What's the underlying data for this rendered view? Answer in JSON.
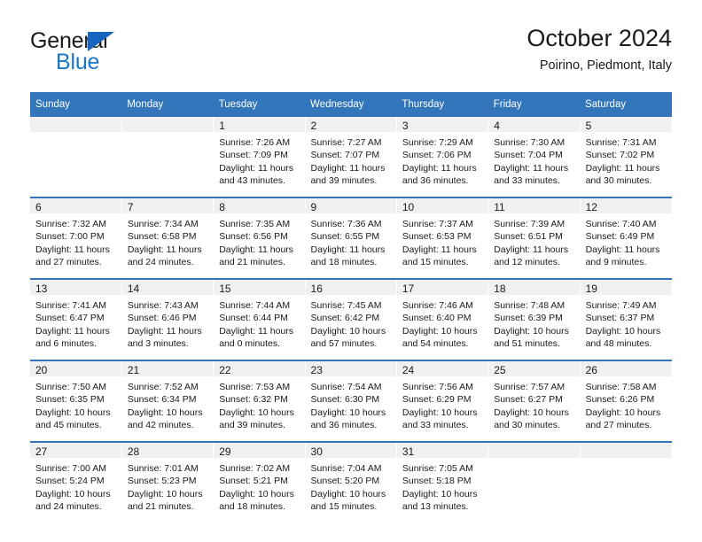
{
  "brand": {
    "name_part1": "General",
    "name_part2": "Blue",
    "triangle_icon": "blue-triangle-logo-mark",
    "colors": {
      "dark": "#1b1b1b",
      "blue": "#1878c8",
      "triangle": "#1565c0"
    }
  },
  "header": {
    "title": "October 2024",
    "subtitle": "Poirino, Piedmont, Italy"
  },
  "theme": {
    "header_bg": "#3275ba",
    "header_text": "#ffffff",
    "daynum_band_bg": "#f0f0f0",
    "cell_bg": "#ffffff",
    "text": "#1a1a1a"
  },
  "weekdays": [
    "Sunday",
    "Monday",
    "Tuesday",
    "Wednesday",
    "Thursday",
    "Friday",
    "Saturday"
  ],
  "labels": {
    "sunrise_prefix": "Sunrise:",
    "sunset_prefix": "Sunset:",
    "daylight_prefix": "Daylight:"
  },
  "weeks": [
    [
      {
        "empty": true
      },
      {
        "empty": true
      },
      {
        "day": "1",
        "sunrise": "Sunrise: 7:26 AM",
        "sunset": "Sunset: 7:09 PM",
        "daylight_1": "Daylight: 11 hours",
        "daylight_2": "and 43 minutes."
      },
      {
        "day": "2",
        "sunrise": "Sunrise: 7:27 AM",
        "sunset": "Sunset: 7:07 PM",
        "daylight_1": "Daylight: 11 hours",
        "daylight_2": "and 39 minutes."
      },
      {
        "day": "3",
        "sunrise": "Sunrise: 7:29 AM",
        "sunset": "Sunset: 7:06 PM",
        "daylight_1": "Daylight: 11 hours",
        "daylight_2": "and 36 minutes."
      },
      {
        "day": "4",
        "sunrise": "Sunrise: 7:30 AM",
        "sunset": "Sunset: 7:04 PM",
        "daylight_1": "Daylight: 11 hours",
        "daylight_2": "and 33 minutes."
      },
      {
        "day": "5",
        "sunrise": "Sunrise: 7:31 AM",
        "sunset": "Sunset: 7:02 PM",
        "daylight_1": "Daylight: 11 hours",
        "daylight_2": "and 30 minutes."
      }
    ],
    [
      {
        "day": "6",
        "sunrise": "Sunrise: 7:32 AM",
        "sunset": "Sunset: 7:00 PM",
        "daylight_1": "Daylight: 11 hours",
        "daylight_2": "and 27 minutes."
      },
      {
        "day": "7",
        "sunrise": "Sunrise: 7:34 AM",
        "sunset": "Sunset: 6:58 PM",
        "daylight_1": "Daylight: 11 hours",
        "daylight_2": "and 24 minutes."
      },
      {
        "day": "8",
        "sunrise": "Sunrise: 7:35 AM",
        "sunset": "Sunset: 6:56 PM",
        "daylight_1": "Daylight: 11 hours",
        "daylight_2": "and 21 minutes."
      },
      {
        "day": "9",
        "sunrise": "Sunrise: 7:36 AM",
        "sunset": "Sunset: 6:55 PM",
        "daylight_1": "Daylight: 11 hours",
        "daylight_2": "and 18 minutes."
      },
      {
        "day": "10",
        "sunrise": "Sunrise: 7:37 AM",
        "sunset": "Sunset: 6:53 PM",
        "daylight_1": "Daylight: 11 hours",
        "daylight_2": "and 15 minutes."
      },
      {
        "day": "11",
        "sunrise": "Sunrise: 7:39 AM",
        "sunset": "Sunset: 6:51 PM",
        "daylight_1": "Daylight: 11 hours",
        "daylight_2": "and 12 minutes."
      },
      {
        "day": "12",
        "sunrise": "Sunrise: 7:40 AM",
        "sunset": "Sunset: 6:49 PM",
        "daylight_1": "Daylight: 11 hours",
        "daylight_2": "and 9 minutes."
      }
    ],
    [
      {
        "day": "13",
        "sunrise": "Sunrise: 7:41 AM",
        "sunset": "Sunset: 6:47 PM",
        "daylight_1": "Daylight: 11 hours",
        "daylight_2": "and 6 minutes."
      },
      {
        "day": "14",
        "sunrise": "Sunrise: 7:43 AM",
        "sunset": "Sunset: 6:46 PM",
        "daylight_1": "Daylight: 11 hours",
        "daylight_2": "and 3 minutes."
      },
      {
        "day": "15",
        "sunrise": "Sunrise: 7:44 AM",
        "sunset": "Sunset: 6:44 PM",
        "daylight_1": "Daylight: 11 hours",
        "daylight_2": "and 0 minutes."
      },
      {
        "day": "16",
        "sunrise": "Sunrise: 7:45 AM",
        "sunset": "Sunset: 6:42 PM",
        "daylight_1": "Daylight: 10 hours",
        "daylight_2": "and 57 minutes."
      },
      {
        "day": "17",
        "sunrise": "Sunrise: 7:46 AM",
        "sunset": "Sunset: 6:40 PM",
        "daylight_1": "Daylight: 10 hours",
        "daylight_2": "and 54 minutes."
      },
      {
        "day": "18",
        "sunrise": "Sunrise: 7:48 AM",
        "sunset": "Sunset: 6:39 PM",
        "daylight_1": "Daylight: 10 hours",
        "daylight_2": "and 51 minutes."
      },
      {
        "day": "19",
        "sunrise": "Sunrise: 7:49 AM",
        "sunset": "Sunset: 6:37 PM",
        "daylight_1": "Daylight: 10 hours",
        "daylight_2": "and 48 minutes."
      }
    ],
    [
      {
        "day": "20",
        "sunrise": "Sunrise: 7:50 AM",
        "sunset": "Sunset: 6:35 PM",
        "daylight_1": "Daylight: 10 hours",
        "daylight_2": "and 45 minutes."
      },
      {
        "day": "21",
        "sunrise": "Sunrise: 7:52 AM",
        "sunset": "Sunset: 6:34 PM",
        "daylight_1": "Daylight: 10 hours",
        "daylight_2": "and 42 minutes."
      },
      {
        "day": "22",
        "sunrise": "Sunrise: 7:53 AM",
        "sunset": "Sunset: 6:32 PM",
        "daylight_1": "Daylight: 10 hours",
        "daylight_2": "and 39 minutes."
      },
      {
        "day": "23",
        "sunrise": "Sunrise: 7:54 AM",
        "sunset": "Sunset: 6:30 PM",
        "daylight_1": "Daylight: 10 hours",
        "daylight_2": "and 36 minutes."
      },
      {
        "day": "24",
        "sunrise": "Sunrise: 7:56 AM",
        "sunset": "Sunset: 6:29 PM",
        "daylight_1": "Daylight: 10 hours",
        "daylight_2": "and 33 minutes."
      },
      {
        "day": "25",
        "sunrise": "Sunrise: 7:57 AM",
        "sunset": "Sunset: 6:27 PM",
        "daylight_1": "Daylight: 10 hours",
        "daylight_2": "and 30 minutes."
      },
      {
        "day": "26",
        "sunrise": "Sunrise: 7:58 AM",
        "sunset": "Sunset: 6:26 PM",
        "daylight_1": "Daylight: 10 hours",
        "daylight_2": "and 27 minutes."
      }
    ],
    [
      {
        "day": "27",
        "sunrise": "Sunrise: 7:00 AM",
        "sunset": "Sunset: 5:24 PM",
        "daylight_1": "Daylight: 10 hours",
        "daylight_2": "and 24 minutes."
      },
      {
        "day": "28",
        "sunrise": "Sunrise: 7:01 AM",
        "sunset": "Sunset: 5:23 PM",
        "daylight_1": "Daylight: 10 hours",
        "daylight_2": "and 21 minutes."
      },
      {
        "day": "29",
        "sunrise": "Sunrise: 7:02 AM",
        "sunset": "Sunset: 5:21 PM",
        "daylight_1": "Daylight: 10 hours",
        "daylight_2": "and 18 minutes."
      },
      {
        "day": "30",
        "sunrise": "Sunrise: 7:04 AM",
        "sunset": "Sunset: 5:20 PM",
        "daylight_1": "Daylight: 10 hours",
        "daylight_2": "and 15 minutes."
      },
      {
        "day": "31",
        "sunrise": "Sunrise: 7:05 AM",
        "sunset": "Sunset: 5:18 PM",
        "daylight_1": "Daylight: 10 hours",
        "daylight_2": "and 13 minutes."
      },
      {
        "empty": true
      },
      {
        "empty": true
      }
    ]
  ]
}
